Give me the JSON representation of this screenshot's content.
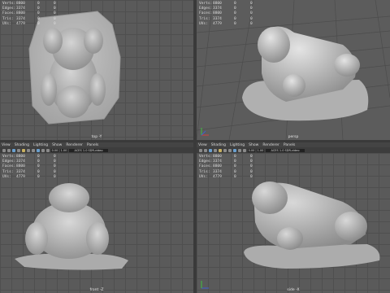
{
  "hud_stats": [
    {
      "label": "Verts:",
      "v1": "8800",
      "v2": "0",
      "v3": "0"
    },
    {
      "label": "Edges:",
      "v1": "3374",
      "v2": "0",
      "v3": "0"
    },
    {
      "label": "Faces:",
      "v1": "8800",
      "v2": "0",
      "v3": "0"
    },
    {
      "label": "Tris:",
      "v1": "3374",
      "v2": "0",
      "v3": "0"
    },
    {
      "label": "UVs:",
      "v1": "4779",
      "v2": "0",
      "v3": "0"
    }
  ],
  "viewports": {
    "top": {
      "label": "top -Y"
    },
    "persp": {
      "label": "persp"
    },
    "front": {
      "label": "front -Z"
    },
    "side": {
      "label": "side -X"
    }
  },
  "menus": {
    "left": [
      "View",
      "Shading",
      "Lighting",
      "Show",
      "Renderer",
      "Panels"
    ],
    "right": [
      "View",
      "Shading",
      "Lighting",
      "Show",
      "Renderer",
      "Panels"
    ]
  },
  "toolbar": {
    "field_a": "0.00",
    "field_b": "1.00",
    "color_space": "ACES 1.0 SDR-video"
  },
  "colors": {
    "viewport_bg": "#5a5a5a",
    "model": "#a8a8a8",
    "axis_x": "#d04040",
    "axis_y": "#40c040",
    "axis_z": "#4060d0"
  }
}
